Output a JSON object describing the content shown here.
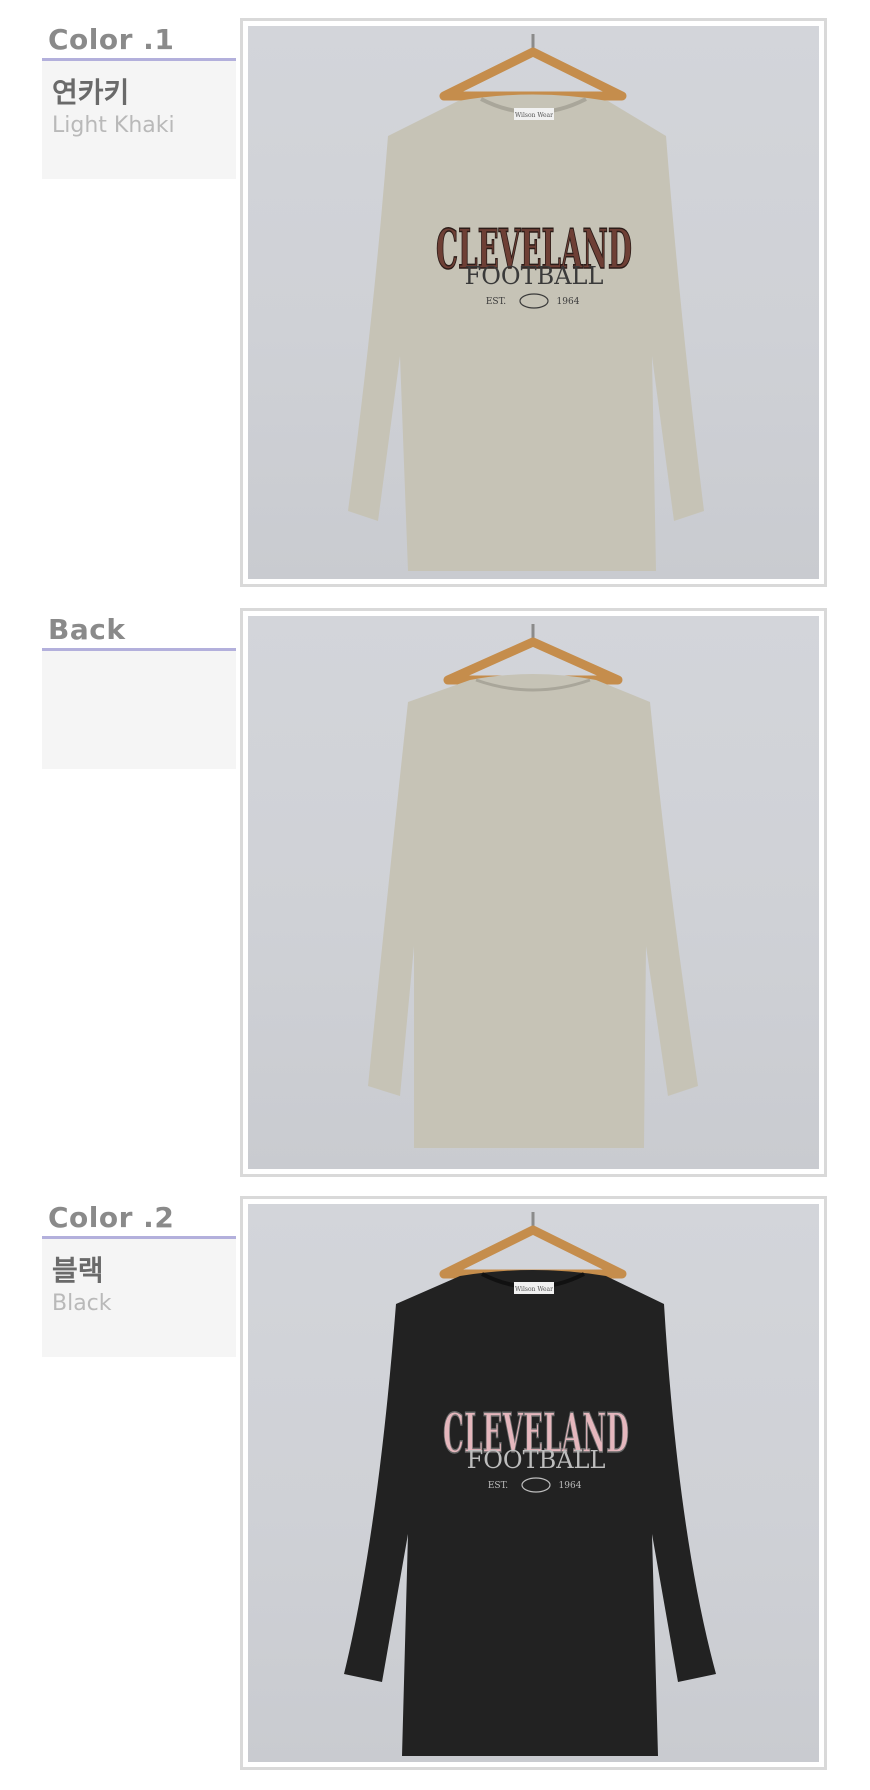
{
  "sections": [
    {
      "heading": "Color .1",
      "name_ko": "연카키",
      "name_en": "Light Khaki",
      "view": "front",
      "shirt_color": "#c6c3b6",
      "print_main": "CLEVELAND",
      "print_sub": "FOOTBALL",
      "print_est": "EST.",
      "print_year": "1964",
      "print_color": "#6e3f35",
      "tag_text": "Wilson Wear"
    },
    {
      "heading": "Back",
      "view": "back",
      "shirt_color": "#c6c3b6"
    },
    {
      "heading": "Color .2",
      "name_ko": "블랙",
      "name_en": "Black",
      "view": "front",
      "shirt_color": "#222222",
      "print_main": "CLEVELAND",
      "print_sub": "FOOTBALL",
      "print_est": "EST.",
      "print_year": "1964",
      "print_color": "#e5b7bd",
      "tag_text": "Wilson Wear"
    }
  ],
  "colors": {
    "heading": "#8a8a8a",
    "heading_underline": "#b3b0dc",
    "label_box_bg": "#f5f5f5",
    "frame_border": "#d9d9d9",
    "photo_bg": "#d1d3d8"
  }
}
